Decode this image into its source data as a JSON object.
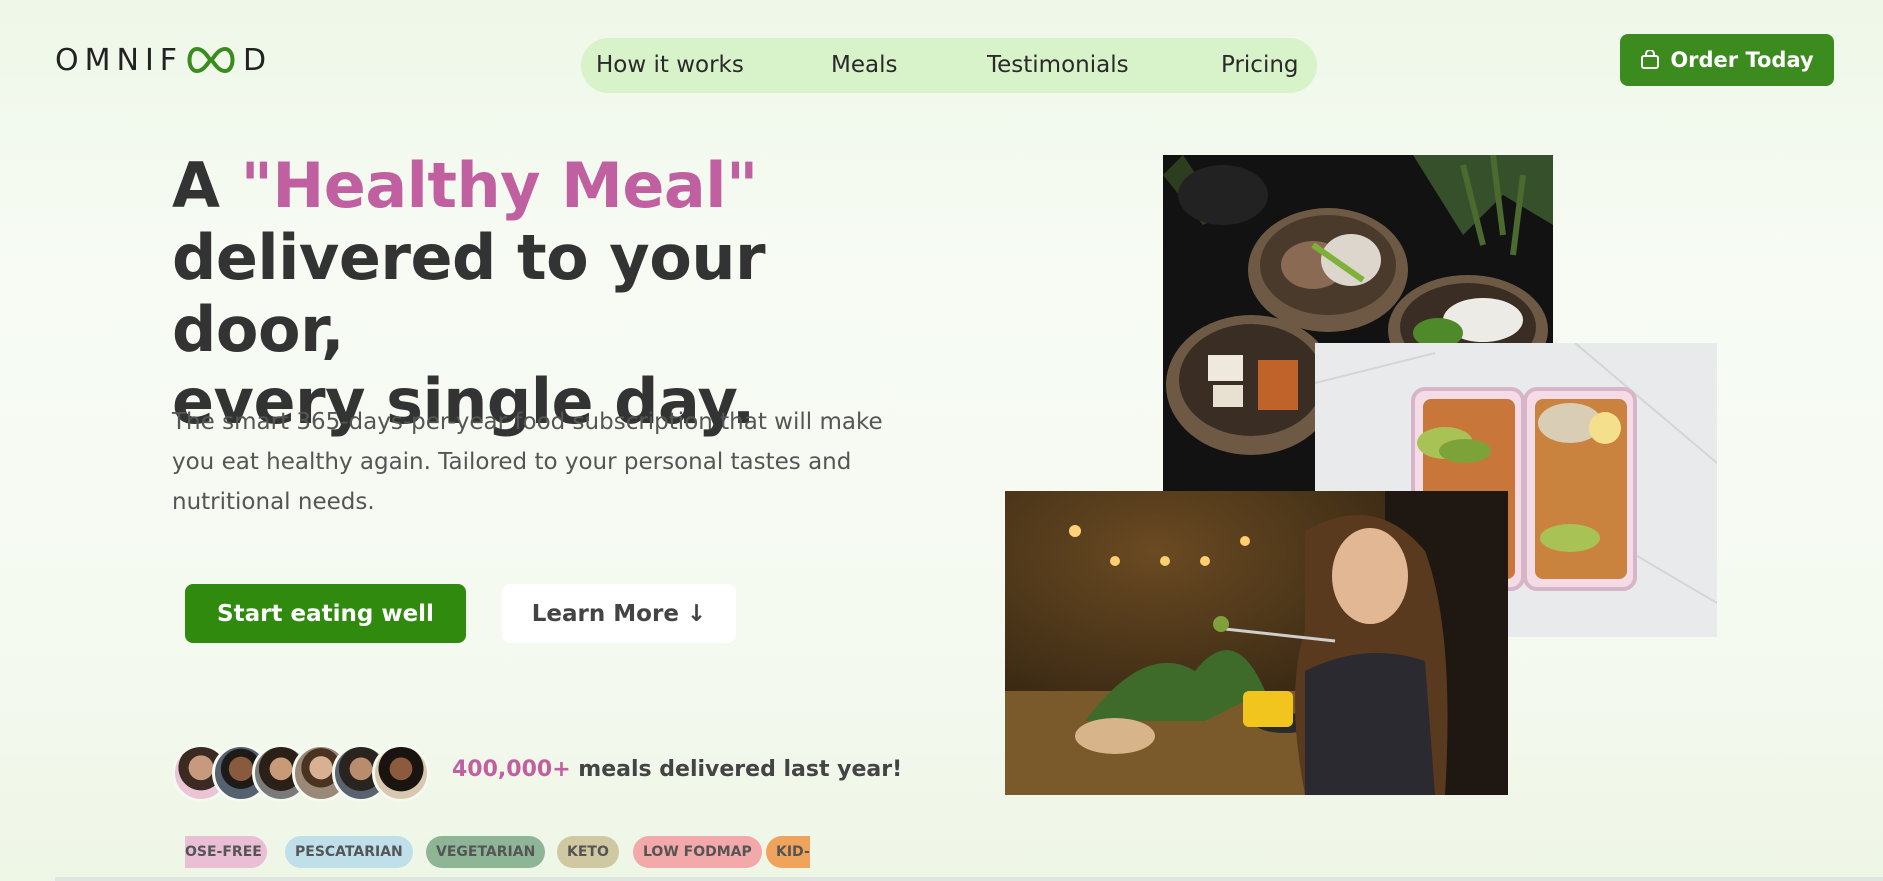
{
  "brand": {
    "logo_text_left": "OMNIF",
    "logo_text_right": "D"
  },
  "nav": {
    "items": [
      {
        "label": "How it works"
      },
      {
        "label": "Meals"
      },
      {
        "label": "Testimonials"
      },
      {
        "label": "Pricing"
      }
    ],
    "cta_label": "Order Today"
  },
  "hero": {
    "title_prefix": "A ",
    "title_accent": "\"Healthy Meal\"",
    "title_line2": "delivered to your door,",
    "title_line3": "every single day.",
    "description": "The smart 365-days-per-year food subscription that will make you eat healthy again. Tailored to your personal tastes and nutritional needs.",
    "primary_button": "Start eating well",
    "secondary_button": "Learn More ↓"
  },
  "stats": {
    "highlight": "400,000+",
    "text": " meals delivered last year!"
  },
  "tags": [
    {
      "label": "OSE-FREE",
      "color": "#eabfd6"
    },
    {
      "label": "PESCATARIAN",
      "color": "#bfe0ea"
    },
    {
      "label": "VEGETARIAN",
      "color": "#8fb597"
    },
    {
      "label": "KETO",
      "color": "#cfc8a0"
    },
    {
      "label": "LOW FODMAP",
      "color": "#f3a9a9"
    },
    {
      "label": "KID-",
      "color": "#f0a35a"
    }
  ],
  "colors": {
    "accent": "#c060a0",
    "primary": "#2f8a0e",
    "nav_bg": "#d8f2c9"
  },
  "icons": {
    "cart": "shopping-bag-icon",
    "logo": "infinity-logo-icon"
  }
}
